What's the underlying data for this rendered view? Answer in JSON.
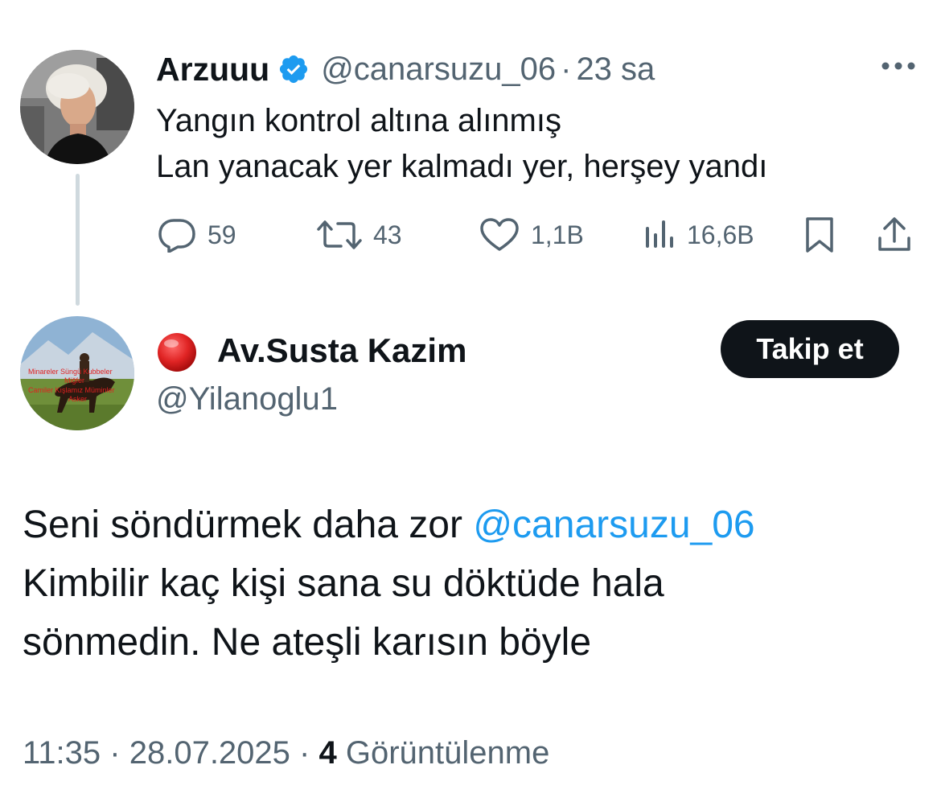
{
  "parent_tweet": {
    "display_name": "Arzuuu",
    "handle": "@canarsuzu_06",
    "separator": "·",
    "time": "23 sa",
    "text_lines": [
      "Yangın kontrol altına alınmış",
      "Lan yanacak yer kalmadı yer, herşey yandı"
    ],
    "replies": "59",
    "retweets": "43",
    "likes": "1,1B",
    "views": "16,6B",
    "verified_icon": "verified-badge-icon",
    "more_icon": "more-horizontal-icon"
  },
  "reply_tweet": {
    "prefix_emoji": "🔴",
    "display_name": "Av.Susta Kazim",
    "handle": "@Yilanoglu1",
    "follow_label": "Takip et",
    "text_part1": "Seni söndürmek daha zor ",
    "mention": "@canarsuzu_06",
    "text_line2": "Kimbilir kaç kişi sana su döktüde hala",
    "text_line3": "sönmedin. Ne ateşli karısın böyle",
    "time": "11:35",
    "separator": "·",
    "date": "28.07.2025",
    "views_count": "4",
    "views_label": "Görüntülenme"
  },
  "colors": {
    "text_primary": "#0f1419",
    "text_secondary": "#536471",
    "accent_blue": "#1d9bf0",
    "thread_line": "#cfd9de",
    "follow_bg": "#0f1419"
  }
}
